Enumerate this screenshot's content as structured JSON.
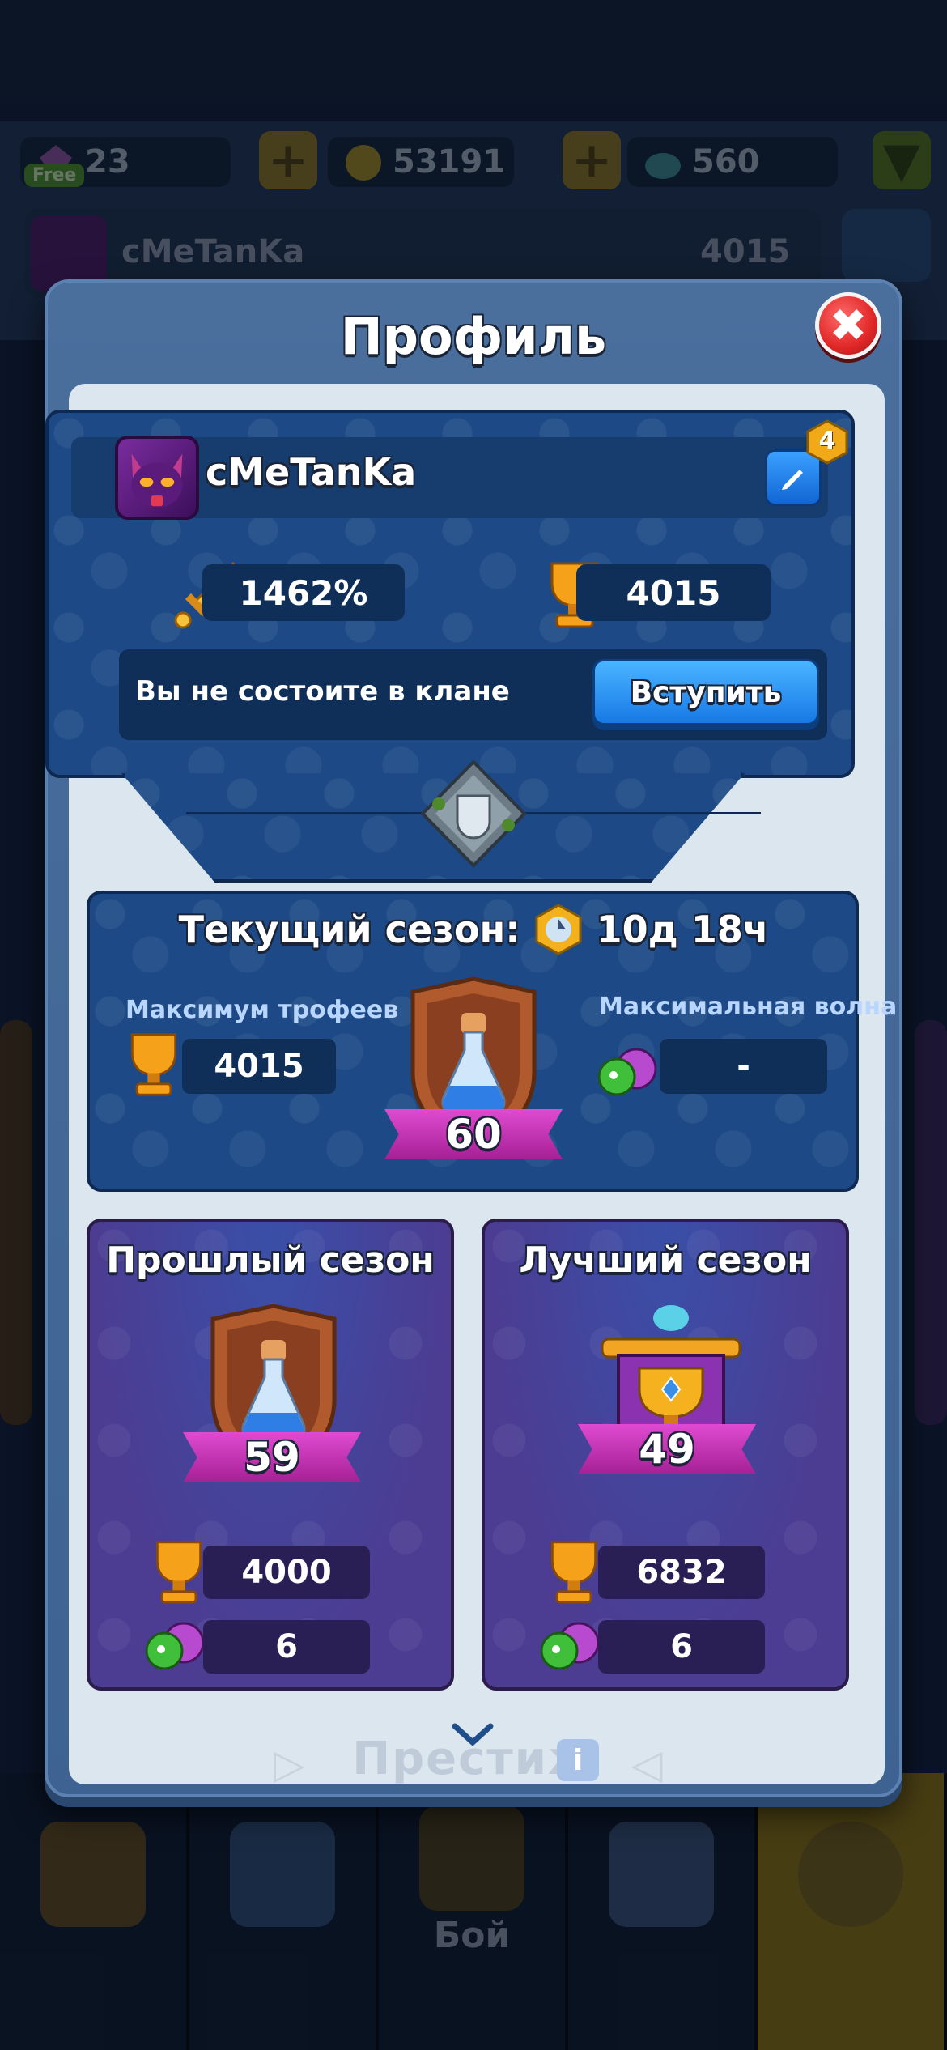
{
  "top_bar": {
    "gems": "23",
    "free_label": "Free",
    "coins": "53191",
    "shards": "560"
  },
  "bg_profile": {
    "name": "cMeTanKa",
    "trophies": "4015",
    "level": "4"
  },
  "modal": {
    "title": "Профиль",
    "close_label": "✖"
  },
  "player": {
    "name": "cMeTanKa",
    "level": "4",
    "crit_stat": "1462%",
    "trophies": "4015",
    "clan_status": "Вы не состоите в клане",
    "join_label": "Вступить"
  },
  "current_season": {
    "title": "Текущий сезон:",
    "time_left": "10д 18ч",
    "max_trophies_label": "Максимум трофеев",
    "max_trophies": "4015",
    "max_wave_label": "Максимальная волна",
    "max_wave": "-",
    "rank": "60"
  },
  "past_season": {
    "title": "Прошлый сезон",
    "rank": "59",
    "trophies": "4000",
    "wave": "6"
  },
  "best_season": {
    "title": "Лучший сезон",
    "rank": "49",
    "trophies": "6832",
    "wave": "6"
  },
  "footer": {
    "prestige_label": "Престиж",
    "info_label": "i"
  },
  "nav": {
    "battle_label": "Бой"
  },
  "colors": {
    "accent_blue": "#1779e6",
    "card_blue": "#1d4a86",
    "card_purple": "#4c3c92",
    "ribbon_pink": "#e04bd1",
    "close_red": "#e02727"
  }
}
